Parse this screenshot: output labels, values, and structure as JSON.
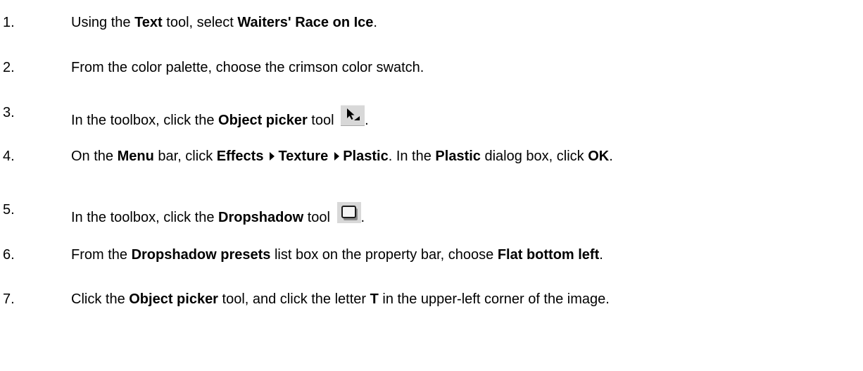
{
  "steps": [
    {
      "number": "1.",
      "parts": [
        {
          "t": "Using the ",
          "b": false
        },
        {
          "t": "Text",
          "b": true
        },
        {
          "t": " tool, select ",
          "b": false
        },
        {
          "t": "Waiters' Race on Ice",
          "b": true
        },
        {
          "t": ".",
          "b": false
        }
      ]
    },
    {
      "number": "2.",
      "parts": [
        {
          "t": "From the color palette, choose the crimson color swatch.",
          "b": false
        }
      ]
    },
    {
      "number": "3.",
      "parts": [
        {
          "t": "In the toolbox, click the ",
          "b": false
        },
        {
          "t": "Object picker",
          "b": true
        },
        {
          "t": " tool ",
          "b": false
        },
        {
          "icon": "object-picker-tool-icon"
        },
        {
          "t": ".",
          "b": false
        }
      ]
    },
    {
      "number": "4.",
      "parts": [
        {
          "t": "On the ",
          "b": false
        },
        {
          "t": "Menu",
          "b": true
        },
        {
          "t": " bar, click ",
          "b": false
        },
        {
          "t": "Effects",
          "b": true
        },
        {
          "arrow": true
        },
        {
          "t": "Texture",
          "b": true
        },
        {
          "arrow": true
        },
        {
          "t": "Plastic",
          "b": true
        },
        {
          "t": ". In the ",
          "b": false
        },
        {
          "t": "Plastic",
          "b": true
        },
        {
          "t": " dialog box, click ",
          "b": false
        },
        {
          "t": "OK",
          "b": true
        },
        {
          "t": ".",
          "b": false
        }
      ]
    },
    {
      "number": "5.",
      "parts": [
        {
          "t": "In the toolbox, click the ",
          "b": false
        },
        {
          "t": "Dropshadow",
          "b": true
        },
        {
          "t": " tool ",
          "b": false
        },
        {
          "icon": "dropshadow-tool-icon"
        },
        {
          "t": ".",
          "b": false
        }
      ]
    },
    {
      "number": "6.",
      "parts": [
        {
          "t": "From the ",
          "b": false
        },
        {
          "t": "Dropshadow presets",
          "b": true
        },
        {
          "t": " list box on the property bar, choose ",
          "b": false
        },
        {
          "t": "Flat bottom left",
          "b": true
        },
        {
          "t": ".",
          "b": false
        }
      ]
    },
    {
      "number": "7.",
      "parts": [
        {
          "t": "Click the ",
          "b": false
        },
        {
          "t": "Object picker",
          "b": true
        },
        {
          "t": " tool, and click the letter ",
          "b": false
        },
        {
          "t": "T",
          "b": true
        },
        {
          "t": " in the upper-left corner of the image.",
          "b": false
        }
      ]
    }
  ],
  "icons": {
    "arrow": "right-triangle-arrow",
    "object_picker": "object-picker-tool-icon",
    "dropshadow": "dropshadow-tool-icon"
  }
}
